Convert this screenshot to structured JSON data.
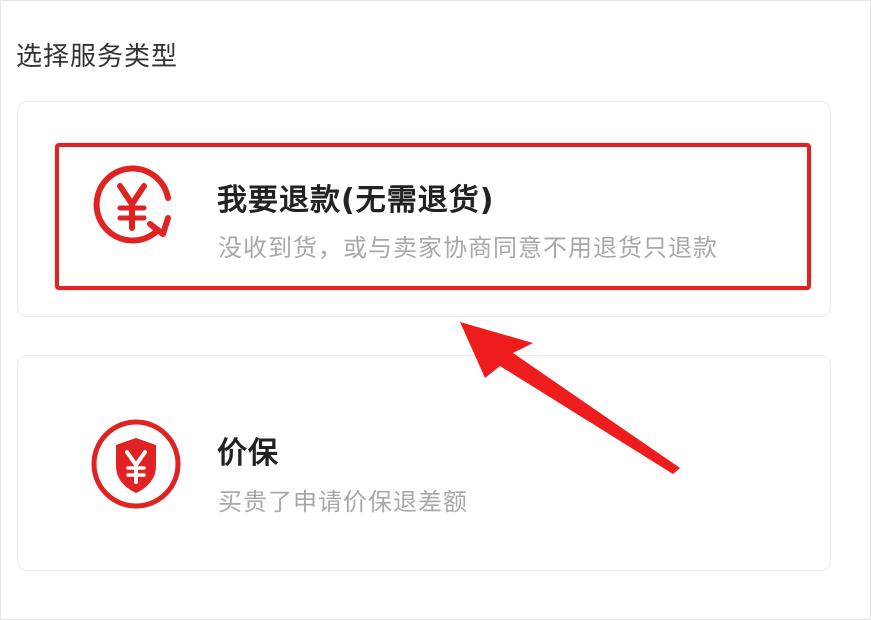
{
  "page": {
    "title": "选择服务类型"
  },
  "services": [
    {
      "title": "我要退款(无需退货)",
      "description": "没收到货，或与卖家协商同意不用退货只退款",
      "icon": "yen-refund-circle-icon"
    },
    {
      "title": "价保",
      "description": "买贵了申请价保退差额",
      "icon": "yen-shield-icon"
    }
  ],
  "colors": {
    "accent": "#e02222",
    "title_text": "#222222",
    "desc_text": "#a8a8a8",
    "card_border": "#ececec"
  },
  "annotation": {
    "highlight": "red-rectangle-around-refund-option",
    "arrow": "red-arrow-pointing-to-refund-option"
  }
}
